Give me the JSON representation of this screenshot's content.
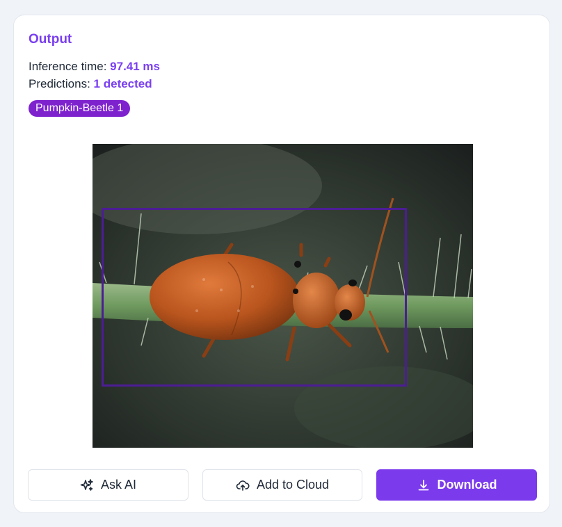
{
  "output": {
    "title": "Output",
    "inference_label": "Inference time: ",
    "inference_value": "97.41 ms",
    "predictions_label": "Predictions: ",
    "predictions_value": "1 detected",
    "labels": [
      "Pumpkin-Beetle 1"
    ]
  },
  "image": {
    "subject": "orange pumpkin beetle on a green hairy stem",
    "detections": [
      {
        "label": "Pumpkin-Beetle"
      }
    ]
  },
  "actions": {
    "ask_ai": "Ask AI",
    "add_to_cloud": "Add to Cloud",
    "download": "Download"
  },
  "colors": {
    "accent": "#7c3aed",
    "badge": "#7e22ce",
    "bbox": "#4c1d95",
    "background": "#f0f3f8"
  },
  "icons": {
    "ask_ai": "sparkles-icon",
    "add_to_cloud": "cloud-upload-icon",
    "download": "download-icon"
  }
}
